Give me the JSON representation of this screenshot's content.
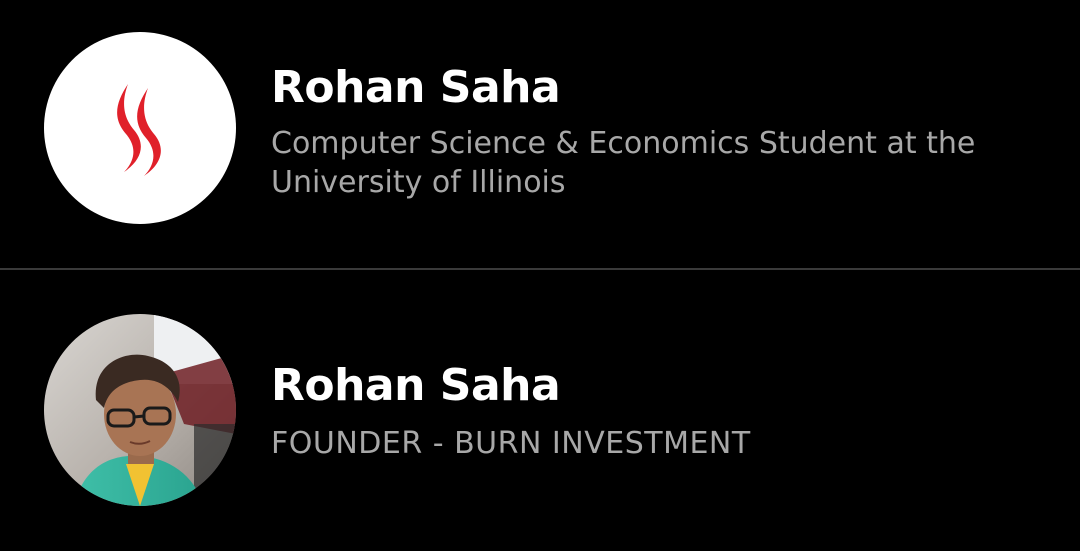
{
  "results": [
    {
      "name": "Rohan Saha",
      "subtitle": "Computer Science & Economics Student at the University of Illinois",
      "avatar_icon": "flame-logo-icon",
      "avatar_color": "#e0202a"
    },
    {
      "name": "Rohan Saha",
      "subtitle": "FOUNDER - BURN INVESTMENT",
      "avatar_icon": "profile-photo"
    }
  ],
  "colors": {
    "background": "#000000",
    "name": "#ffffff",
    "subtitle": "#a8a8a8",
    "divider": "#3a3a3a"
  }
}
